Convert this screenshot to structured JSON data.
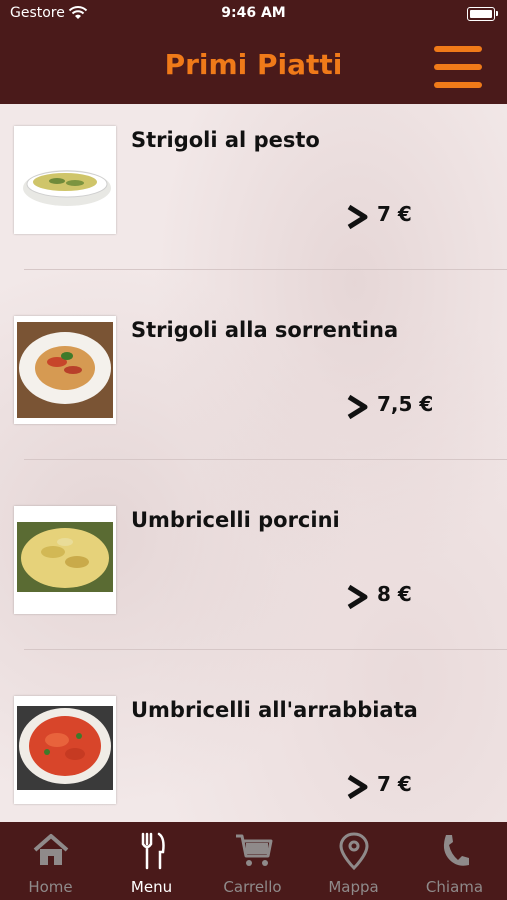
{
  "status_bar": {
    "carrier": "Gestore",
    "time": "9:46 AM"
  },
  "header": {
    "title": "Primi Piatti"
  },
  "menu_items": [
    {
      "name": "Strigoli al pesto",
      "price": "7 €"
    },
    {
      "name": "Strigoli alla sorrentina",
      "price": "7,5 €"
    },
    {
      "name": "Umbricelli porcini",
      "price": "8 €"
    },
    {
      "name": "Umbricelli all'arrabbiata",
      "price": "7 €"
    }
  ],
  "tab_bar": {
    "tabs": [
      {
        "label": "Home",
        "icon": "home-icon"
      },
      {
        "label": "Menu",
        "icon": "fork-knife-icon",
        "active": true
      },
      {
        "label": "Carrello",
        "icon": "cart-icon"
      },
      {
        "label": "Mappa",
        "icon": "map-pin-icon"
      },
      {
        "label": "Chiama",
        "icon": "phone-icon"
      }
    ]
  },
  "colors": {
    "bar": "#4a1a1a",
    "accent": "#f07a19",
    "inactive_tab": "#8f8a8a"
  }
}
